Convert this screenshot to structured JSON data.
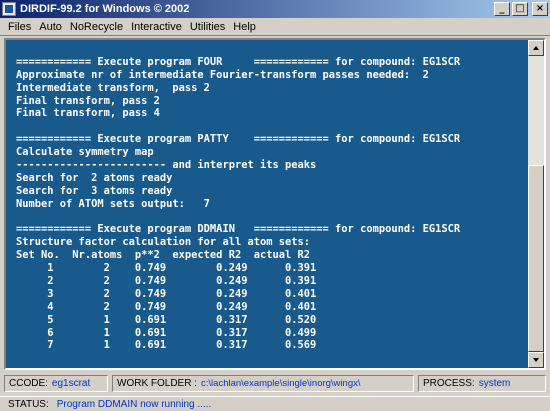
{
  "window": {
    "title": "DIRDIF-99.2 for Windows  © 2002",
    "minimize": "_",
    "maximize": "□",
    "close": "×"
  },
  "menu": [
    "Files",
    "Auto",
    "NoRecycle",
    "Interactive",
    "Utilities",
    "Help"
  ],
  "console": {
    "lines": [
      "",
      "============ Execute program FOUR     ============ for compound: EG1SCR",
      "Approximate nr of intermediate Fourier-transform passes needed:  2",
      "Intermediate transform,  pass 2",
      "Final transform, pass 2",
      "Final transform, pass 4",
      "",
      "============ Execute program PATTY    ============ for compound: EG1SCR",
      "Calculate symmetry map",
      "------------------------ and interpret its peaks",
      "Search for  2 atoms ready",
      "Search for  3 atoms ready",
      "Number of ATOM sets output:   7",
      "",
      "============ Execute program DDMAIN   ============ for compound: EG1SCR",
      "Structure factor calculation for all atom sets:",
      "Set No.  Nr.atoms  p**2  expected R2  actual R2",
      "     1        2    0.749        0.249      0.391",
      "     2        2    0.749        0.249      0.391",
      "     3        2    0.749        0.249      0.401",
      "     4        2    0.749        0.249      0.401",
      "     5        1    0.691        0.317      0.520",
      "     6        1    0.691        0.317      0.499",
      "     7        1    0.691        0.317      0.569"
    ]
  },
  "info": {
    "ccode_label": "CCODE:",
    "ccode_value": "eg1scrat",
    "work_label": "WORK FOLDER :",
    "work_value": "c:\\lachlan\\example\\single\\inorg\\wingx\\",
    "process_label": "PROCESS:",
    "process_value": "system"
  },
  "status": {
    "label": "STATUS:",
    "value": "Program DDMAIN now running ....."
  }
}
